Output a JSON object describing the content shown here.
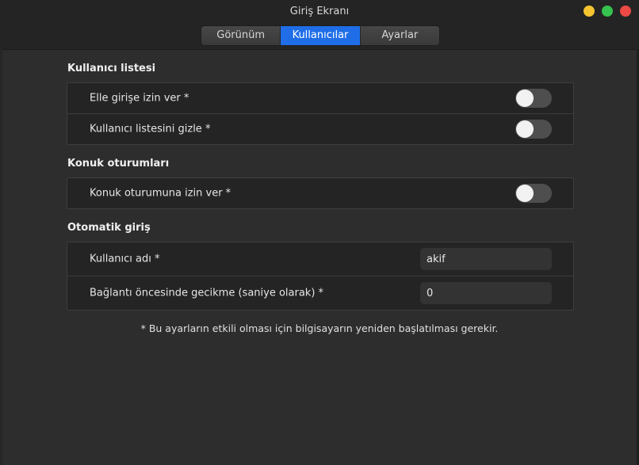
{
  "window": {
    "title": "Giriş Ekranı"
  },
  "tabs": [
    {
      "label": "Görünüm",
      "active": false
    },
    {
      "label": "Kullanıcılar",
      "active": true
    },
    {
      "label": "Ayarlar",
      "active": false
    }
  ],
  "sections": {
    "user_list": {
      "title": "Kullanıcı listesi",
      "rows": [
        {
          "label": "Elle girişe izin ver *",
          "value": false
        },
        {
          "label": "Kullanıcı listesini gizle *",
          "value": false
        }
      ]
    },
    "guest": {
      "title": "Konuk oturumları",
      "rows": [
        {
          "label": "Konuk oturumuna izin ver *",
          "value": false
        }
      ]
    },
    "autologin": {
      "title": "Otomatik giriş",
      "rows": [
        {
          "label": "Kullanıcı adı *",
          "value": "akif"
        },
        {
          "label": "Bağlantı öncesinde gecikme (saniye olarak) *",
          "value": "0"
        }
      ]
    }
  },
  "footnote": "* Bu ayarların etkili olması için bilgisayarın yeniden başlatılması gerekir.",
  "colors": {
    "accent": "#1f6ee8",
    "minimize": "#f5c431",
    "maximize": "#36c24e",
    "close": "#ed4a45"
  }
}
